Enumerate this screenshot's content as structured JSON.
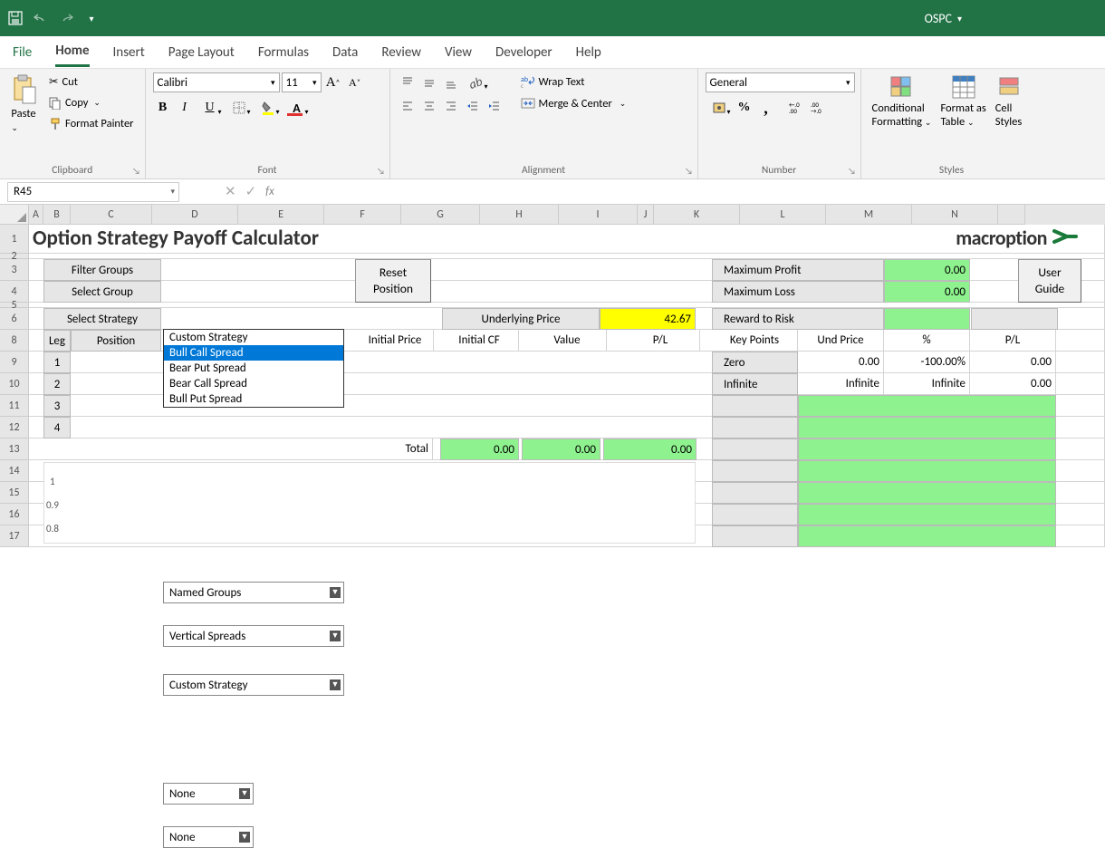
{
  "titlebar": {
    "doc": "OSPC"
  },
  "tabs": {
    "file": "File",
    "home": "Home",
    "insert": "Insert",
    "page_layout": "Page Layout",
    "formulas": "Formulas",
    "data": "Data",
    "review": "Review",
    "view": "View",
    "developer": "Developer",
    "help": "Help"
  },
  "ribbon": {
    "clipboard": {
      "paste": "Paste",
      "cut": "Cut",
      "copy": "Copy",
      "painter": "Format Painter",
      "label": "Clipboard"
    },
    "font": {
      "name": "Calibri",
      "size": "11",
      "label": "Font"
    },
    "alignment": {
      "wrap": "Wrap Text",
      "merge": "Merge & Center",
      "label": "Alignment"
    },
    "number": {
      "fmt": "General",
      "label": "Number"
    },
    "styles": {
      "cond": "Conditional",
      "cond2": "Formatting",
      "tbl": "Format as",
      "tbl2": "Table",
      "cell": "Cell",
      "cell2": "Styles",
      "label": "Styles"
    }
  },
  "namebox": "R45",
  "columns": [
    "A",
    "B",
    "C",
    "D",
    "E",
    "F",
    "G",
    "H",
    "I",
    "J",
    "K",
    "L",
    "M",
    "N"
  ],
  "rownums": [
    "1",
    "2",
    "3",
    "4",
    "5",
    "6",
    "8",
    "9",
    "10",
    "11",
    "12",
    "13",
    "14",
    "15",
    "16",
    "17"
  ],
  "sheet": {
    "title": "Option Strategy Payoff Calculator",
    "logo": "macroption",
    "filter_groups_lbl": "Filter Groups",
    "select_group_lbl": "Select Group",
    "select_strategy_lbl": "Select Strategy",
    "filter_groups_val": "Named Groups",
    "select_group_val": "Vertical Spreads",
    "select_strategy_val": "Custom Strategy",
    "reset_btn": "Reset\nPosition",
    "user_guide_btn": "User\nGuide",
    "underlying_price_lbl": "Underlying Price",
    "underlying_price_val": "42.67",
    "max_profit_lbl": "Maximum Profit",
    "max_profit_val": "0.00",
    "max_loss_lbl": "Maximum Loss",
    "max_loss_val": "0.00",
    "reward_risk_lbl": "Reward to Risk",
    "headers_left": [
      "Leg",
      "Position",
      "",
      "",
      "Initial Price",
      "Initial CF",
      "Value",
      "P/L"
    ],
    "headers_right": [
      "Key Points",
      "Und Price",
      "%",
      "P/L"
    ],
    "legs": [
      "1",
      "2",
      "3",
      "4"
    ],
    "leg_none": "None",
    "total_lbl": "Total",
    "total_vals": [
      "0.00",
      "0.00",
      "0.00"
    ],
    "kp": {
      "r1": [
        "Zero",
        "0.00",
        "-100.00%",
        "0.00"
      ],
      "r2": [
        "Infinite",
        "Infinite",
        "Infinite",
        "0.00"
      ]
    },
    "chart_y": [
      "1",
      "0.9",
      "0.8"
    ]
  },
  "dropdown": {
    "options": [
      "Custom Strategy",
      "Bull Call Spread",
      "Bear Put Spread",
      "Bear Call Spread",
      "Bull Put Spread"
    ],
    "selected_index": 1
  }
}
